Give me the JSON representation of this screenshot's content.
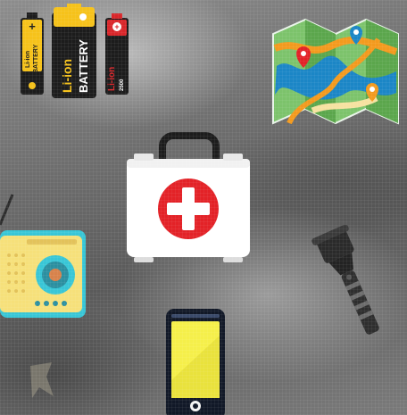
{
  "scene": {
    "items": {
      "batteries": {
        "icon": "battery-icon",
        "small_cell": {
          "line1": "Li-ion",
          "line2": "BATTERY"
        },
        "large_cell": {
          "line1": "Li-ion",
          "line2": "BATTERY"
        },
        "red_cell": {
          "line1": "Li-ion",
          "line2": "2500"
        }
      },
      "map": {
        "icon": "map-icon"
      },
      "first_aid_kit": {
        "icon": "first-aid-icon"
      },
      "radio": {
        "icon": "radio-icon"
      },
      "flashlight": {
        "icon": "flashlight-icon"
      },
      "smartphone": {
        "icon": "smartphone-icon"
      }
    },
    "colors": {
      "battery_yellow": "#f6c21a",
      "battery_black": "#1c1c1c",
      "battery_red": "#d9262a",
      "kit_red": "#e32227",
      "kit_white": "#ffffff",
      "radio_yellow": "#f6e07a",
      "radio_cyan": "#38c6d6",
      "phone_screen": "#f5ef4a",
      "phone_body": "#111827",
      "map_green": "#7cc36b",
      "map_blue": "#1b86c6",
      "map_orange": "#f39a1e"
    }
  }
}
